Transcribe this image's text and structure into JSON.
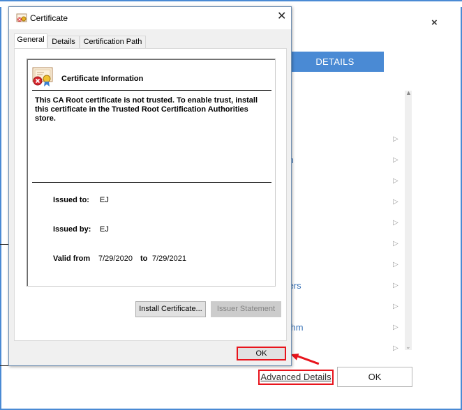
{
  "background_window": {
    "details_tab_label": "DETAILS",
    "close_glyph": "×",
    "list_fragments": [
      "m",
      "ters",
      "ithm"
    ],
    "ok_label": "OK",
    "advanced_details_link": "Advanced Details"
  },
  "certificate_dialog": {
    "title": "Certificate",
    "close_glyph": "✕",
    "tabs": [
      "General",
      "Details",
      "Certification Path"
    ],
    "active_tab": "General",
    "info_heading": "Certificate Information",
    "warning_text": "This CA Root certificate is not trusted. To enable trust, install this certificate in the Trusted Root Certification Authorities store.",
    "issued_to_label": "Issued to:",
    "issued_to_value": "EJ",
    "issued_by_label": "Issued by:",
    "issued_by_value": "EJ",
    "valid_from_label": "Valid from",
    "valid_from_value": "7/29/2020",
    "valid_to_label": "to",
    "valid_to_value": "7/29/2021",
    "install_certificate_button": "Install Certificate...",
    "issuer_statement_button": "Issuer Statement",
    "ok_button": "OK"
  },
  "colors": {
    "accent_blue": "#4a8ad4",
    "highlight_red": "#e8141c",
    "link_blue": "#3a73b7"
  },
  "icons": [
    "certificate-icon",
    "close-icon",
    "chevron-right-icon",
    "scroll-up-icon",
    "scroll-down-icon",
    "red-arrow-annotation"
  ]
}
